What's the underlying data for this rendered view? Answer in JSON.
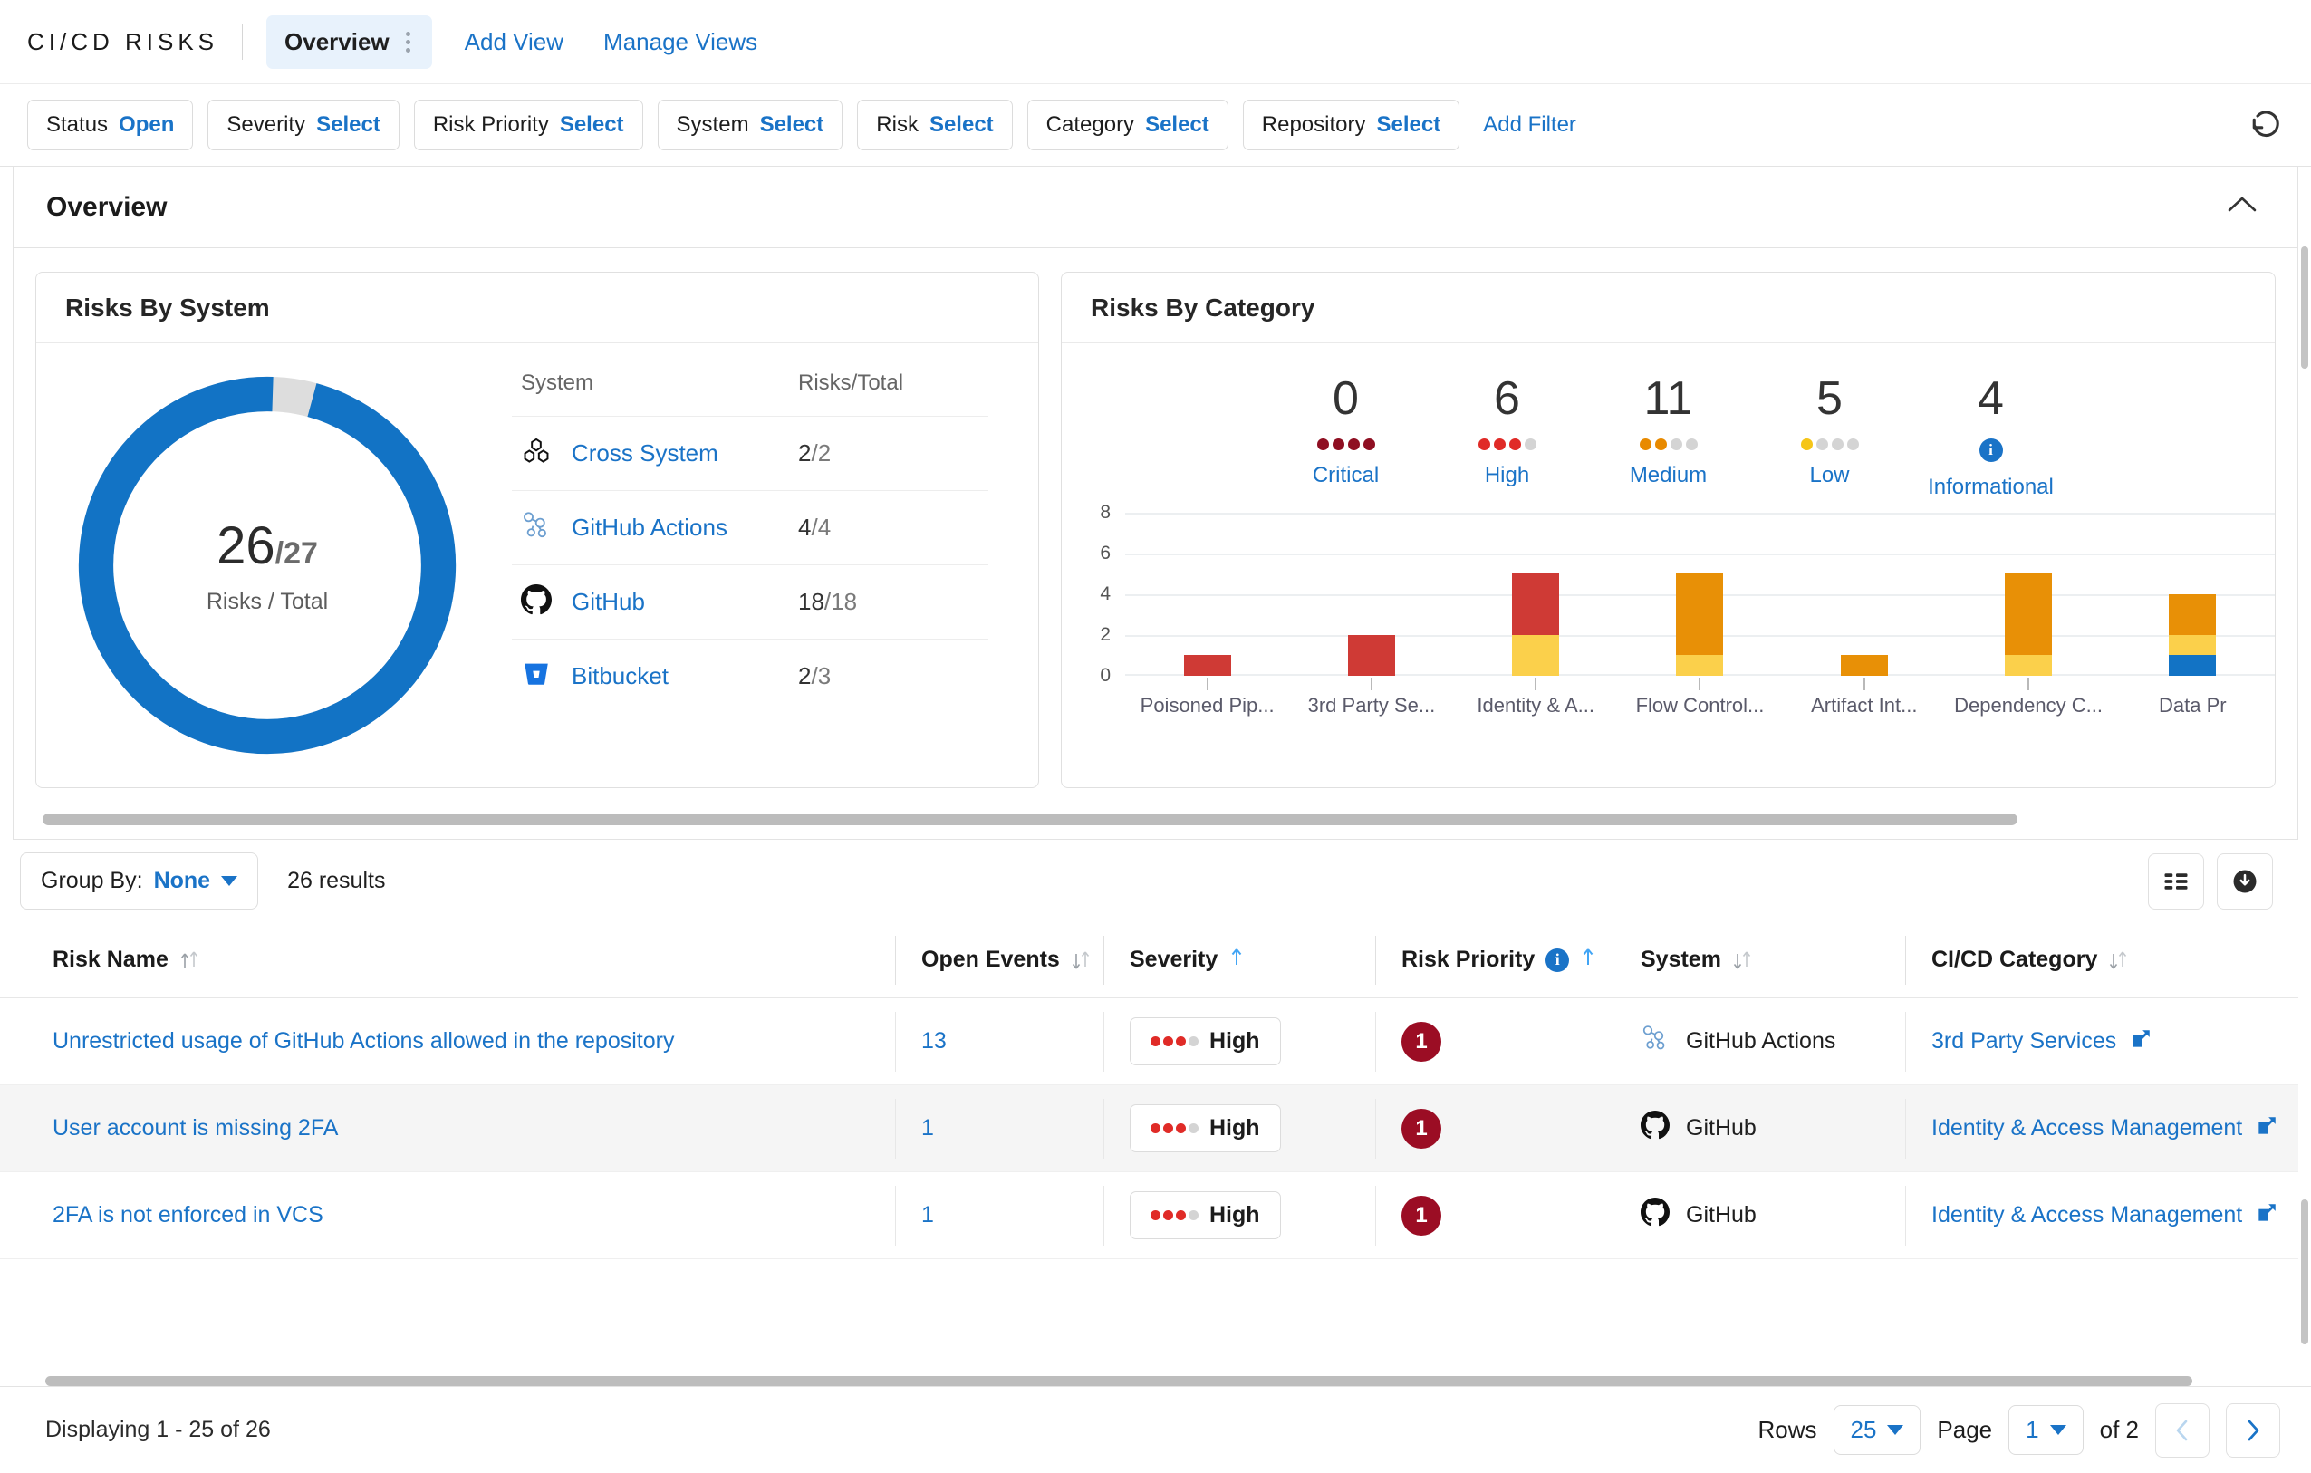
{
  "header": {
    "brand": "CI/CD RISKS",
    "active_tab": "Overview",
    "add_view": "Add View",
    "manage_views": "Manage Views"
  },
  "filters": {
    "chips": [
      {
        "key": "Status",
        "value": "Open"
      },
      {
        "key": "Severity",
        "value": "Select"
      },
      {
        "key": "Risk Priority",
        "value": "Select"
      },
      {
        "key": "System",
        "value": "Select"
      },
      {
        "key": "Risk",
        "value": "Select"
      },
      {
        "key": "Category",
        "value": "Select"
      },
      {
        "key": "Repository",
        "value": "Select"
      }
    ],
    "add_filter": "Add Filter"
  },
  "overview": {
    "title": "Overview",
    "risks_by_system": {
      "title": "Risks By System",
      "donut": {
        "value": "26",
        "separator": "/",
        "total": "27",
        "caption": "Risks / Total"
      },
      "columns": [
        "System",
        "Risks/Total"
      ],
      "rows": [
        {
          "system": "Cross System",
          "icon": "cross-system-icon",
          "risks": "2",
          "total": "2"
        },
        {
          "system": "GitHub Actions",
          "icon": "github-actions-icon",
          "risks": "4",
          "total": "4"
        },
        {
          "system": "GitHub",
          "icon": "github-icon",
          "risks": "18",
          "total": "18"
        },
        {
          "system": "Bitbucket",
          "icon": "bitbucket-icon",
          "risks": "2",
          "total": "3"
        }
      ]
    },
    "risks_by_category": {
      "title": "Risks By Category",
      "severity_summary": [
        {
          "label": "Critical",
          "count": "0",
          "filled": 4,
          "color": "#8f0f22"
        },
        {
          "label": "High",
          "count": "6",
          "filled": 3,
          "color": "#e02b27"
        },
        {
          "label": "Medium",
          "count": "11",
          "filled": 2,
          "color": "#e88a00"
        },
        {
          "label": "Low",
          "count": "5",
          "filled": 1,
          "color": "#f5c518"
        },
        {
          "label": "Informational",
          "count": "4",
          "filled": 0,
          "color": "#1a73c7"
        }
      ]
    }
  },
  "chart_data": {
    "type": "bar",
    "title": "Risks By Category",
    "stacked": true,
    "xlabel": "",
    "ylabel": "",
    "ylim": [
      0,
      8
    ],
    "yticks": [
      0,
      2,
      4,
      6,
      8
    ],
    "grid": true,
    "legend": [
      "Critical",
      "High",
      "Medium",
      "Low",
      "Informational"
    ],
    "series_colors": {
      "Critical": "#8f0f22",
      "High": "#cf3a35",
      "Medium": "#e89006",
      "Low": "#fbd04b",
      "Informational": "#1273c5"
    },
    "categories": [
      "Poisoned Pip...",
      "3rd Party Se...",
      "Identity & A...",
      "Flow Control...",
      "Artifact Int...",
      "Dependency C...",
      "Data Pr"
    ],
    "series": [
      {
        "name": "Informational",
        "values": [
          0,
          0,
          0,
          0,
          0,
          0,
          1
        ]
      },
      {
        "name": "Low",
        "values": [
          0,
          0,
          2,
          1,
          0,
          1,
          1
        ]
      },
      {
        "name": "Medium",
        "values": [
          0,
          0,
          0,
          4,
          1,
          4,
          2
        ]
      },
      {
        "name": "High",
        "values": [
          1,
          2,
          3,
          0,
          0,
          0,
          0
        ]
      },
      {
        "name": "Critical",
        "values": [
          0,
          0,
          0,
          0,
          0,
          0,
          0
        ]
      }
    ],
    "totals": [
      1,
      2,
      5,
      5,
      1,
      5,
      4
    ]
  },
  "results": {
    "group_by_label": "Group By:",
    "group_by_value": "None",
    "count_text": "26 results",
    "columns": [
      {
        "label": "Risk Name",
        "sort": "both"
      },
      {
        "label": "Open Events",
        "sort": "both"
      },
      {
        "label": "Severity",
        "sort": "asc"
      },
      {
        "label": "Risk Priority",
        "sort": "asc",
        "info": true
      },
      {
        "label": "System",
        "sort": "both"
      },
      {
        "label": "CI/CD Category",
        "sort": "both"
      }
    ],
    "rows": [
      {
        "name": "Unrestricted usage of GitHub Actions allowed in the repository",
        "open_events": "13",
        "severity": "High",
        "severity_filled": 3,
        "priority": "1",
        "system": "GitHub Actions",
        "system_icon": "github-actions-icon",
        "category": "3rd Party Services"
      },
      {
        "name": "User account is missing 2FA",
        "open_events": "1",
        "severity": "High",
        "severity_filled": 3,
        "priority": "1",
        "system": "GitHub",
        "system_icon": "github-icon",
        "category": "Identity & Access Management"
      },
      {
        "name": "2FA is not enforced in VCS",
        "open_events": "1",
        "severity": "High",
        "severity_filled": 3,
        "priority": "1",
        "system": "GitHub",
        "system_icon": "github-icon",
        "category": "Identity & Access Management"
      }
    ]
  },
  "footer": {
    "displaying": "Displaying 1 - 25 of 26",
    "rows_label": "Rows",
    "rows_value": "25",
    "page_label": "Page",
    "page_value": "1",
    "of_pages": "of 2"
  },
  "colors": {
    "accent": "#1a73c7",
    "critical": "#8f0f22",
    "high": "#cf3a35",
    "medium": "#e89006",
    "low": "#fbd04b",
    "informational": "#1273c5",
    "donut_fill": "#1273c5",
    "donut_rest": "#dddddd",
    "priority_badge": "#9b0d24"
  }
}
